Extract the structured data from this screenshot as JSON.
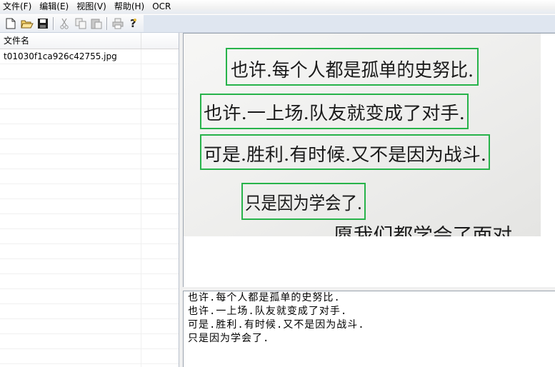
{
  "menu": {
    "items": [
      "文件(F)",
      "编辑(E)",
      "视图(V)",
      "帮助(H)",
      "OCR"
    ]
  },
  "toolbar": {
    "buttons": [
      "new-file-icon",
      "open-folder-icon",
      "save-icon",
      "cut-icon",
      "copy-icon",
      "paste-icon",
      "print-icon",
      "help-icon"
    ]
  },
  "file_list": {
    "column_header": "文件名",
    "rows": [
      "t01030f1ca926c42755.jpg"
    ]
  },
  "image": {
    "handwritten_lines": [
      "也许.每个人都是孤单的史努比.",
      "也许.一上场.队友就变成了对手.",
      "可是.胜利.有时候.又不是因为战斗.",
      "只是因为学会了.",
      "愿我们都学会了面对"
    ],
    "box_color": "#27b34a"
  },
  "ocr_result": {
    "lines": [
      "也许.每个人都是孤单的史努比.",
      "也许.一上场.队友就变成了对手.",
      "可是.胜利.有时候.又不是因为战斗.",
      "只是因为学会了."
    ]
  }
}
